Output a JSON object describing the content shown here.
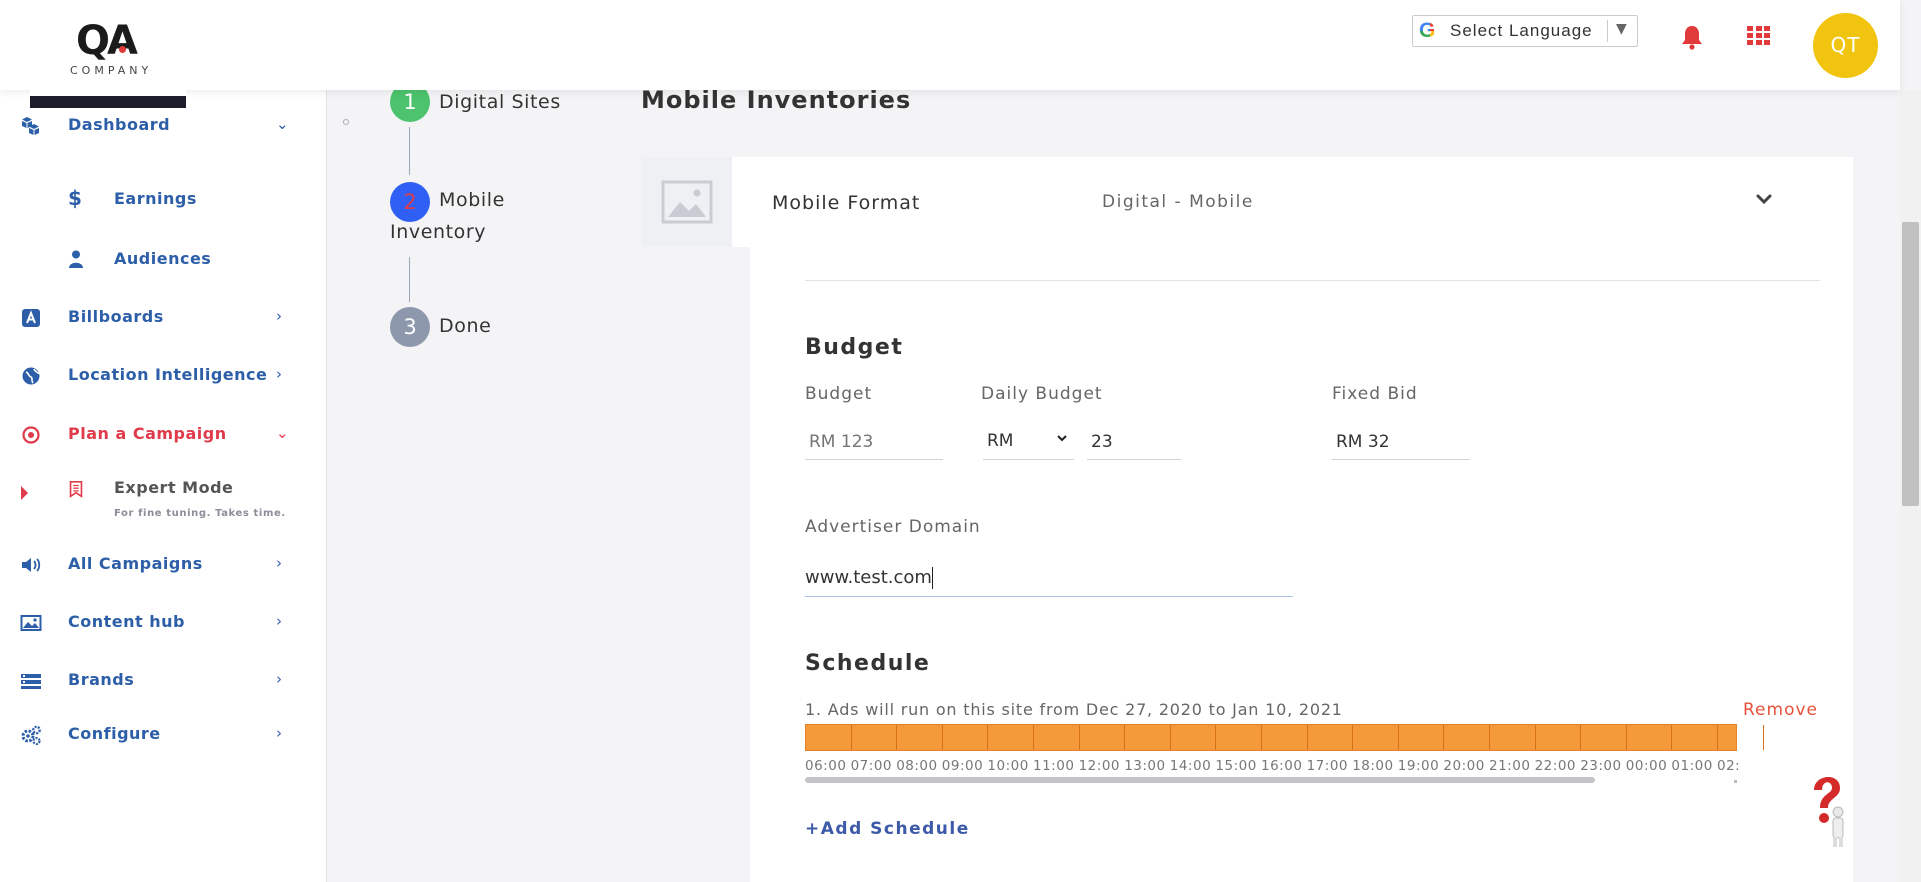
{
  "header": {
    "logo_text": "QA",
    "logo_subtext": "COMPANY",
    "language_label": "Select Language",
    "language_caret": "▼",
    "avatar_initials": "QT",
    "colors": {
      "bell": "#e13a3a",
      "apps": "#e13a3a",
      "avatar": "#f1c40f"
    }
  },
  "sidebar": {
    "items": [
      {
        "label": "Dashboard",
        "icon": "dashboard-cubes-icon",
        "chevron": "down"
      },
      {
        "label": "Earnings",
        "icon": "dollar-icon"
      },
      {
        "label": "Audiences",
        "icon": "user-icon"
      },
      {
        "label": "Billboards",
        "icon": "billboard-letter-a-icon",
        "chevron": "right"
      },
      {
        "label": "Location Intelligence",
        "icon": "globe-icon",
        "chevron": "right"
      },
      {
        "label": "Plan a Campaign",
        "icon": "target-icon",
        "chevron": "down",
        "active": true
      },
      {
        "label": "Expert Mode",
        "subtitle": "For fine tuning. Takes time.",
        "icon": "ribbon-badge-icon"
      },
      {
        "label": "All Campaigns",
        "icon": "megaphone-icon",
        "chevron": "right"
      },
      {
        "label": "Content hub",
        "icon": "image-icon",
        "chevron": "right"
      },
      {
        "label": "Brands",
        "icon": "list-icon",
        "chevron": "right"
      },
      {
        "label": "Configure",
        "icon": "gears-icon",
        "chevron": "right"
      }
    ],
    "chevron_glyphs": {
      "down": "⌄",
      "right": "›"
    }
  },
  "steps": [
    {
      "number": "1",
      "label": "Digital Sites",
      "status": "complete",
      "color": "#4cc36c"
    },
    {
      "number": "2",
      "label_line1": "Mobile",
      "label_line2": "Inventory",
      "status": "current",
      "color": "#2f5ff5",
      "number_color": "#e03b4b"
    },
    {
      "number": "3",
      "label": "Done",
      "status": "pending",
      "color": "#8e98ad"
    }
  ],
  "main": {
    "title": "Mobile Inventories",
    "card": {
      "format_name": "Mobile Format",
      "format_type": "Digital - Mobile"
    },
    "budget": {
      "section_title": "Budget",
      "budget_label": "Budget",
      "budget_placeholder": "RM 123",
      "daily_label": "Daily Budget",
      "currency": "RM",
      "daily_value": "23",
      "fixed_bid_label": "Fixed Bid",
      "fixed_bid_value": "RM 32"
    },
    "advertiser": {
      "label": "Advertiser Domain",
      "value": "www.test.com"
    },
    "schedule": {
      "section_title": "Schedule",
      "entry_text": "1. Ads will run on this site from Dec 27, 2020 to Jan 10, 2021",
      "remove_label": "Remove",
      "hours": [
        "06:00",
        "07:00",
        "08:00",
        "09:00",
        "10:00",
        "11:00",
        "12:00",
        "13:00",
        "14:00",
        "15:00",
        "16:00",
        "17:00",
        "18:00",
        "19:00",
        "20:00",
        "21:00",
        "22:00",
        "23:00",
        "00:00",
        "01:00",
        "02:"
      ],
      "strip_color": "#f59a3a",
      "add_label": "+Add Schedule"
    }
  }
}
